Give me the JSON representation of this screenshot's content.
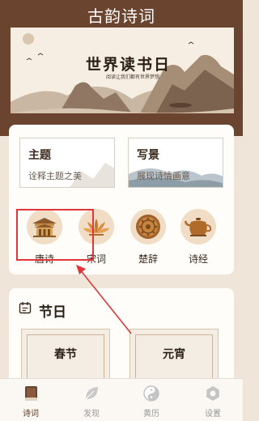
{
  "app": {
    "title": "古韵诗词"
  },
  "banner": {
    "title": "世界读书日",
    "subtitle": "阅读让我们都有世界梦想"
  },
  "theme_cards": [
    {
      "title": "主题",
      "desc": "诠释主题之美"
    },
    {
      "title": "写景",
      "desc": "展现诗情画意"
    }
  ],
  "categories": [
    {
      "label": "唐诗",
      "icon": "palace-icon"
    },
    {
      "label": "宋词",
      "icon": "lotus-icon"
    },
    {
      "label": "楚辞",
      "icon": "bronze-plate-icon"
    },
    {
      "label": "诗经",
      "icon": "teapot-icon"
    }
  ],
  "festival_section": {
    "title": "节日",
    "items": [
      {
        "name": "春节"
      },
      {
        "name": "元宵"
      }
    ]
  },
  "tabs": [
    {
      "label": "诗词",
      "icon": "book-icon"
    },
    {
      "label": "发现",
      "icon": "leaf-icon"
    },
    {
      "label": "黄历",
      "icon": "yin-yang-icon"
    },
    {
      "label": "设置",
      "icon": "gear-icon"
    }
  ],
  "colors": {
    "header": "#6b4430",
    "accent": "#e0363a",
    "background": "#efe5d8"
  }
}
